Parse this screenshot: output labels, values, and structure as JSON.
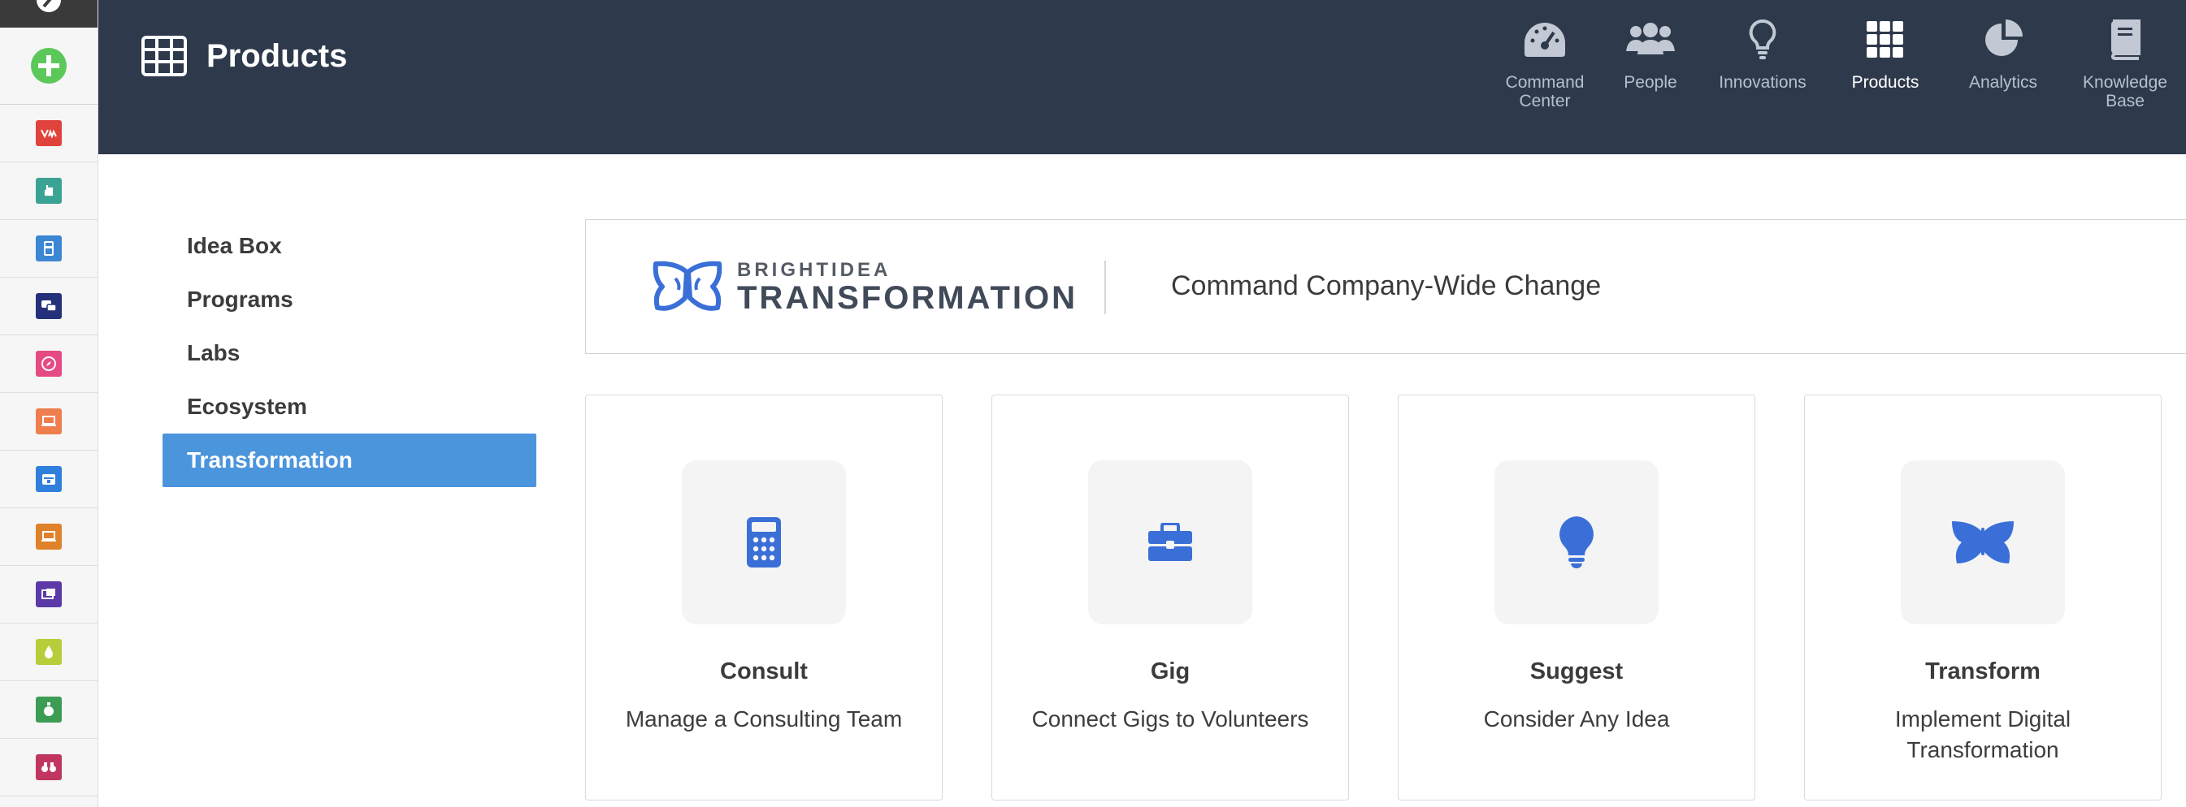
{
  "header": {
    "title": "Products",
    "nav": [
      {
        "label": "Command Center",
        "icon": "speedometer-icon"
      },
      {
        "label": "People",
        "icon": "people-icon"
      },
      {
        "label": "Innovations",
        "icon": "lightbulb-icon"
      },
      {
        "label": "Products",
        "icon": "grid-icon",
        "active": true
      },
      {
        "label": "Analytics",
        "icon": "pie-chart-icon"
      },
      {
        "label": "Knowledge Base",
        "icon": "book-icon"
      }
    ]
  },
  "rail": {
    "apps": [
      {
        "icon": "idea-box-app-icon",
        "color": "#e0433c"
      },
      {
        "icon": "hand-app-icon",
        "color": "#3aa394"
      },
      {
        "icon": "calculator-app-icon",
        "color": "#3b87d4"
      },
      {
        "icon": "chat-app-icon",
        "color": "#25307a"
      },
      {
        "icon": "compass-app-icon",
        "color": "#e64a84"
      },
      {
        "icon": "laptop-app-icon",
        "color": "#ee7e4d"
      },
      {
        "icon": "calendar-app-icon",
        "color": "#2f7fdc"
      },
      {
        "icon": "monitor-app-icon",
        "color": "#e0812c"
      },
      {
        "icon": "gallery-app-icon",
        "color": "#5b3aa8"
      },
      {
        "icon": "drop-app-icon",
        "color": "#b9cc3a"
      },
      {
        "icon": "money-bag-app-icon",
        "color": "#3c9c54"
      },
      {
        "icon": "binoculars-app-icon",
        "color": "#c0365e"
      }
    ]
  },
  "menu": {
    "items": [
      "Idea Box",
      "Programs",
      "Labs",
      "Ecosystem",
      "Transformation"
    ],
    "active": "Transformation"
  },
  "banner": {
    "brand": "BRIGHTIDEA",
    "product": "TRANSFORMATION",
    "tagline": "Command Company-Wide Change",
    "accent": "#3a6fd8"
  },
  "cards": [
    {
      "name": "Consult",
      "desc": "Manage a Consulting Team",
      "icon": "calculator-icon"
    },
    {
      "name": "Gig",
      "desc": "Connect Gigs to Volunteers",
      "icon": "briefcase-icon"
    },
    {
      "name": "Suggest",
      "desc": "Consider Any Idea",
      "icon": "lightbulb-icon"
    },
    {
      "name": "Transform",
      "desc": "Implement Digital Transformation",
      "icon": "butterfly-icon"
    }
  ],
  "colors": {
    "header_bg": "#2e3a4c",
    "active_menu": "#4b95dc",
    "icon_blue": "#3a6fd8"
  }
}
